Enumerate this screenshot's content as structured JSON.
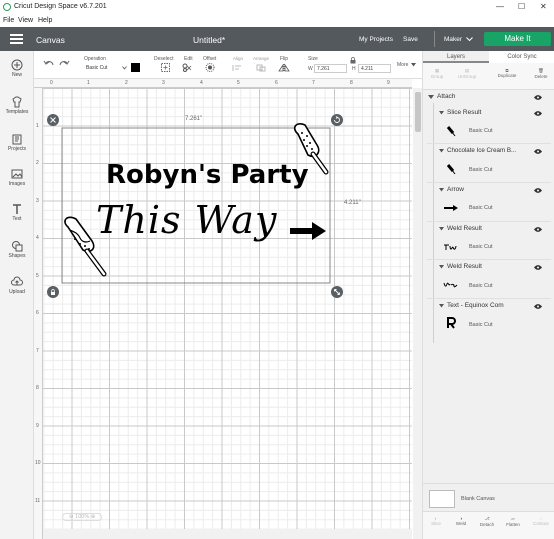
{
  "window": {
    "title": "Cricut Design Space  v6.7.201",
    "controls": [
      "—",
      "☐",
      "✕"
    ]
  },
  "menu": [
    "File",
    "View",
    "Help"
  ],
  "header": {
    "canvas_label": "Canvas",
    "doc_title": "Untitled*",
    "my_projects": "My Projects",
    "save": "Save",
    "machine": "Maker",
    "make_it": "Make It"
  },
  "rail": [
    "New",
    "Templates",
    "Projects",
    "Images",
    "Text",
    "Shapes",
    "Upload"
  ],
  "toolbar": {
    "operation_label": "Operation",
    "operation_value": "Basic Cut",
    "deselect": "Deselect",
    "edit": "Edit",
    "offset": "Offset",
    "align": "Align",
    "arrange": "Arrange",
    "flip": "Flip",
    "size": "Size",
    "w_label": "W",
    "w_value": "7.261",
    "h_label": "H",
    "h_value": "4.211",
    "more": "More"
  },
  "ruler_top": [
    "0",
    "1",
    "2",
    "3",
    "4",
    "5",
    "6",
    "7",
    "8",
    "9"
  ],
  "ruler_left": [
    "1",
    "2",
    "3",
    "4",
    "5",
    "6",
    "7",
    "8",
    "9",
    "10",
    "11"
  ],
  "selection": {
    "width_label": "7.261\"",
    "height_label": "4.211\""
  },
  "design": {
    "line1": "Robyn's Party",
    "line2": "This Way"
  },
  "zoom": "100%",
  "panel": {
    "tabs": [
      "Layers",
      "Color Sync"
    ],
    "actions": [
      "Group",
      "UnGroup",
      "Duplicate",
      "Delete"
    ],
    "group_label": "Attach",
    "layers": [
      {
        "name": "Slice Result",
        "op": "Basic Cut"
      },
      {
        "name": "Chocolate Ice Cream B...",
        "op": "Basic Cut"
      },
      {
        "name": "Arrow",
        "op": "Basic Cut"
      },
      {
        "name": "Weld Result",
        "op": "Basic Cut"
      },
      {
        "name": "Weld Result",
        "op": "Basic Cut"
      },
      {
        "name": "Text - Equinox Com",
        "op": "Basic Cut"
      }
    ],
    "blank_canvas": "Blank Canvas",
    "bottom_actions": [
      "Slice",
      "Weld",
      "Detach",
      "Flatten",
      "Contour"
    ]
  }
}
